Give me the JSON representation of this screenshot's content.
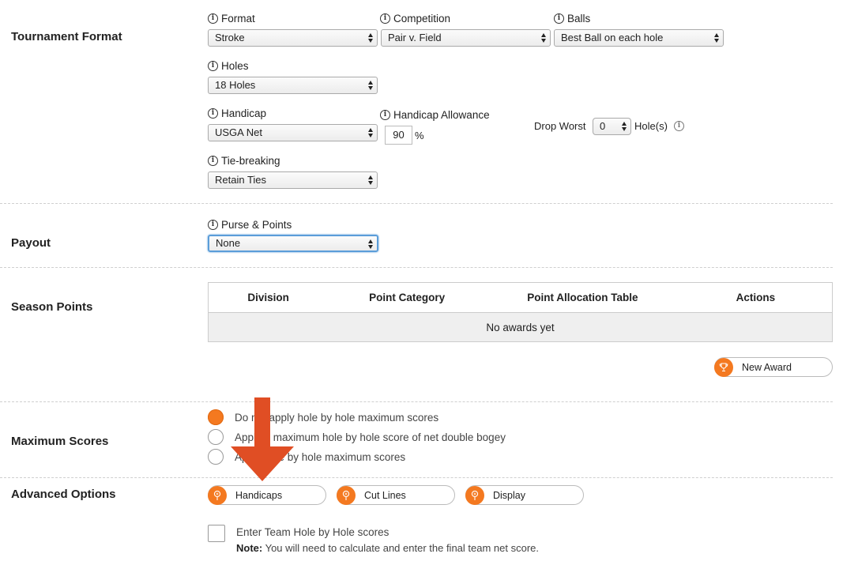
{
  "sections": {
    "tournament_format": "Tournament Format",
    "payout": "Payout",
    "season_points": "Season Points",
    "maximum_scores": "Maximum Scores",
    "advanced_options": "Advanced Options"
  },
  "format": {
    "label": "Format",
    "value": "Stroke"
  },
  "competition": {
    "label": "Competition",
    "value": "Pair v. Field"
  },
  "balls": {
    "label": "Balls",
    "value": "Best Ball on each hole"
  },
  "holes": {
    "label": "Holes",
    "value": "18 Holes"
  },
  "handicap": {
    "label": "Handicap",
    "value": "USGA Net"
  },
  "handicap_allowance": {
    "label": "Handicap Allowance",
    "value": "90",
    "unit": "%"
  },
  "drop_worst": {
    "label": "Drop Worst",
    "value": "0",
    "suffix": "Hole(s)"
  },
  "tie_breaking": {
    "label": "Tie-breaking",
    "value": "Retain Ties"
  },
  "purse": {
    "label": "Purse & Points",
    "value": "None"
  },
  "season_table": {
    "columns": [
      "Division",
      "Point Category",
      "Point Allocation Table",
      "Actions"
    ],
    "empty_text": "No awards yet",
    "new_award": "New Award"
  },
  "max_scores": {
    "options": [
      {
        "label": "Do not apply hole by hole maximum scores",
        "checked": true
      },
      {
        "label": "Apply a maximum hole by hole score of net double bogey",
        "checked": false
      },
      {
        "label": "Apply hole by hole maximum scores",
        "checked": false
      }
    ]
  },
  "advanced": {
    "buttons": [
      "Handicaps",
      "Cut Lines",
      "Display"
    ],
    "team_scores_label": "Enter Team Hole by Hole scores",
    "note_label": "Note:",
    "note_text": " You will need to calculate and enter the final team net score."
  },
  "colors": {
    "accent": "#f47920",
    "arrow": "#e04e24",
    "focus": "#5b9dd9"
  }
}
